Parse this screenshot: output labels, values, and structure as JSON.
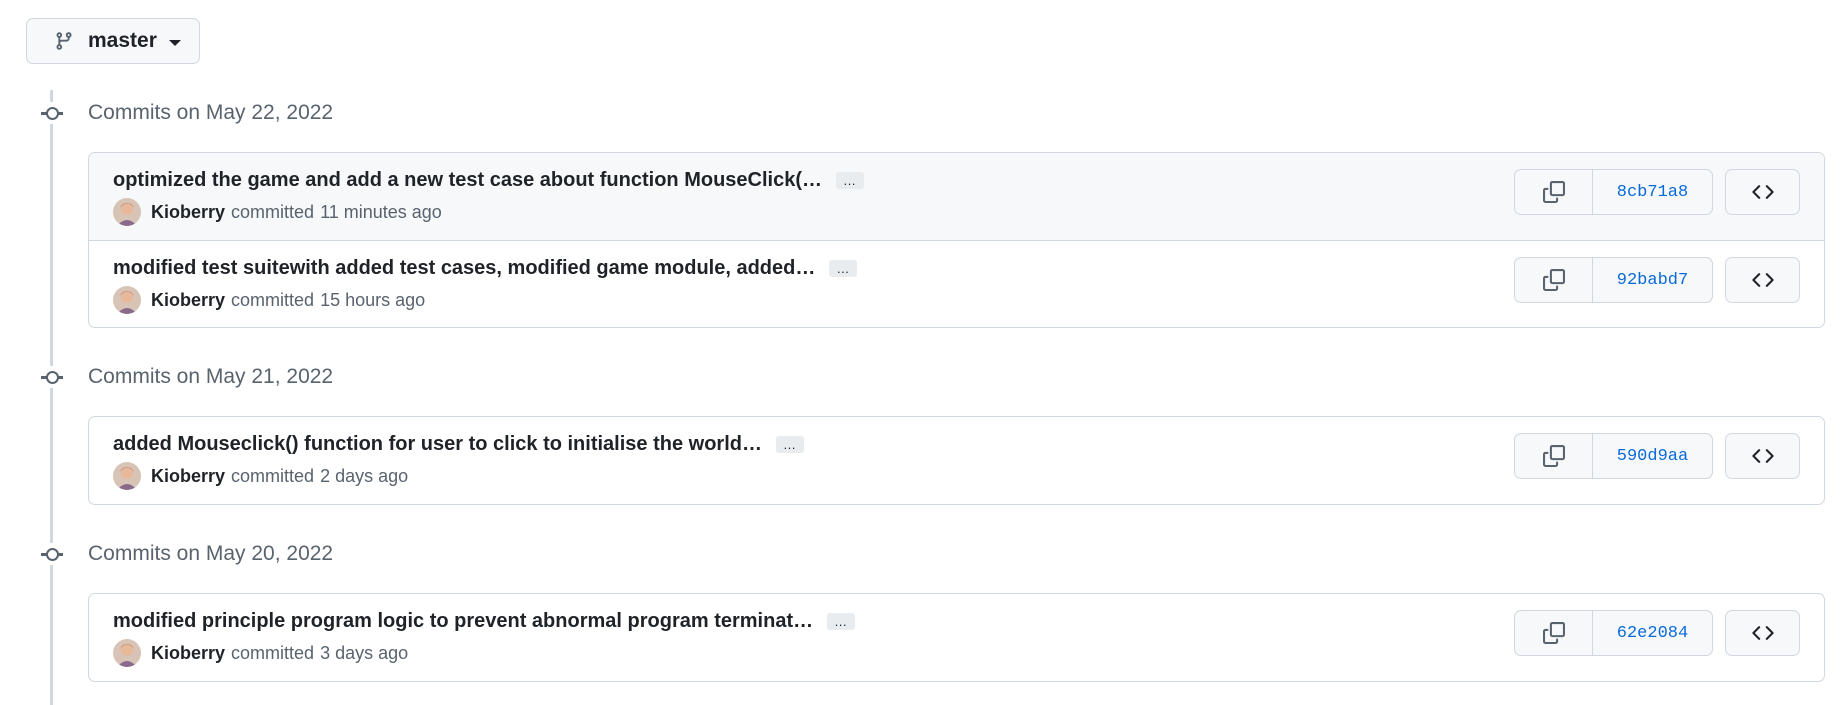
{
  "branch": {
    "name": "master",
    "icon": "git-branch-icon"
  },
  "colors": {
    "accent": "#0969da",
    "muted": "#59636e",
    "border": "#d0d7de",
    "highlight_row": "#f6f8fa"
  },
  "groups": [
    {
      "title": "Commits on May 22, 2022",
      "commits": [
        {
          "message": "optimized the game and add a new test case about function MouseClick(…",
          "ellipsis": "…",
          "author": "Kioberry",
          "verb": "committed",
          "time": "11 minutes ago",
          "sha": "8cb71a8"
        },
        {
          "message": "modified test suitewith added test cases, modified game module, added…",
          "ellipsis": "…",
          "author": "Kioberry",
          "verb": "committed",
          "time": "15 hours ago",
          "sha": "92babd7"
        }
      ]
    },
    {
      "title": "Commits on May 21, 2022",
      "commits": [
        {
          "message": "added Mouseclick() function for user to click to initialise the world…",
          "ellipsis": "…",
          "author": "Kioberry",
          "verb": "committed",
          "time": "2 days ago",
          "sha": "590d9aa"
        }
      ]
    },
    {
      "title": "Commits on May 20, 2022",
      "commits": [
        {
          "message": "modified principle program logic to prevent abnormal program terminat…",
          "ellipsis": "…",
          "author": "Kioberry",
          "verb": "committed",
          "time": "3 days ago",
          "sha": "62e2084"
        }
      ]
    }
  ]
}
